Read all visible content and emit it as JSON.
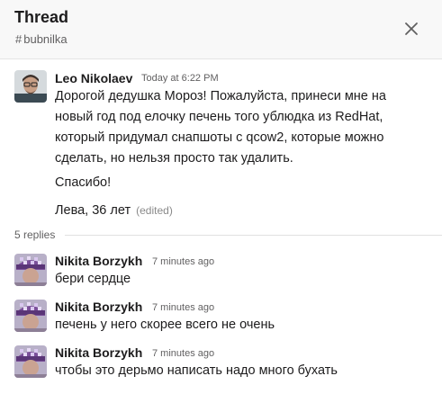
{
  "header": {
    "title": "Thread",
    "channel_hash": "#",
    "channel": "bubnilka"
  },
  "parent": {
    "author": "Leo Nikolaev",
    "time": "Today at 6:22 PM",
    "lines": [
      "Дорогой дедушка Мороз! Пожалуйста, принеси мне на",
      "новый год под елочку печень того ублюдка из RedHat,",
      "который придумал снапшоты с qcow2, которые можно",
      "сделать, но нельзя просто так удалить."
    ],
    "thanks": "Спасибо!",
    "signature": "Лева, 36 лет",
    "edited": "(edited)"
  },
  "replies_label": "5 replies",
  "replies": [
    {
      "author": "Nikita Borzykh",
      "time": "7 minutes ago",
      "text": "бери сердце"
    },
    {
      "author": "Nikita Borzykh",
      "time": "7 minutes ago",
      "text": "печень у него скорее всего не очень"
    },
    {
      "author": "Nikita Borzykh",
      "time": "7 minutes ago",
      "text": "чтобы это дерьмо написать надо много бухать"
    }
  ],
  "icons": {
    "close": "close-icon",
    "avatar_leo": "avatar",
    "avatar_nikita": "avatar"
  }
}
